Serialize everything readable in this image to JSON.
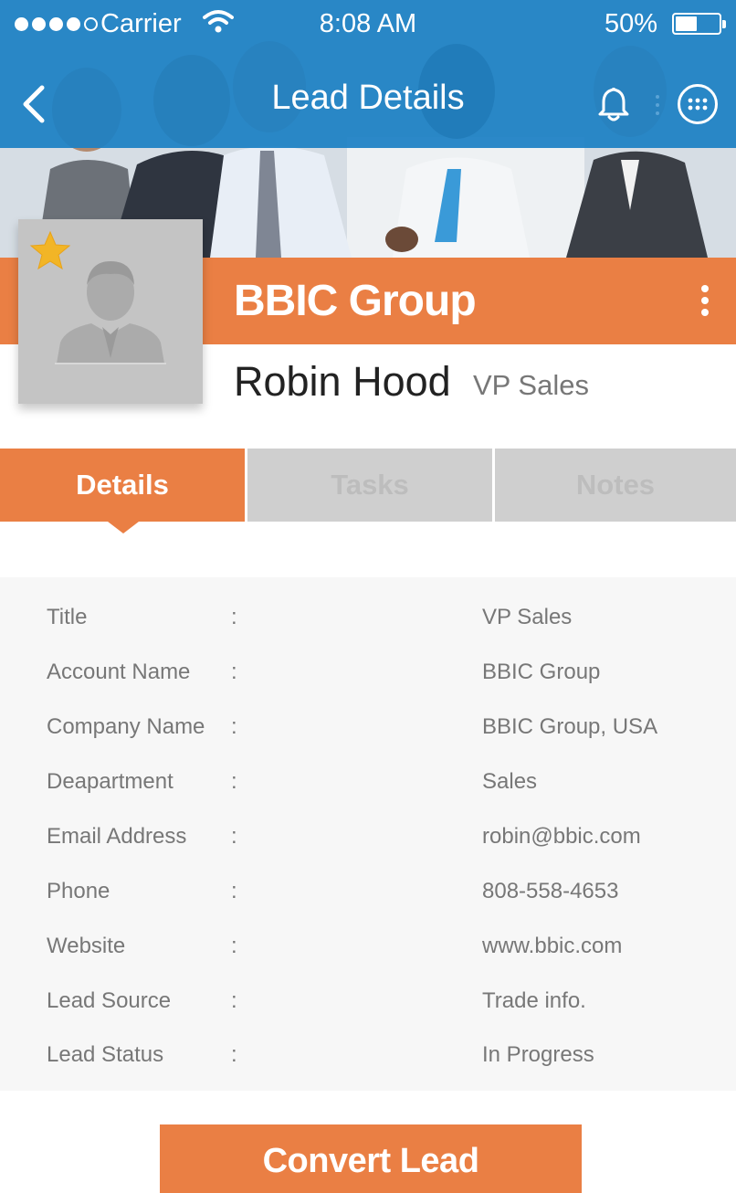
{
  "status_bar": {
    "carrier": "Carrier",
    "time": "8:08 AM",
    "battery": "50%",
    "battery_level": 0.5
  },
  "nav": {
    "title": "Lead Details",
    "back_icon": "chevron-left-icon",
    "notification_icon": "bell-icon",
    "menu_icon": "apps-grid-icon"
  },
  "lead": {
    "company": "BBIC Group",
    "name": "Robin Hood",
    "job_title": "VP Sales",
    "favorite": true
  },
  "tabs": [
    {
      "label": "Details",
      "active": true
    },
    {
      "label": "Tasks",
      "active": false
    },
    {
      "label": "Notes",
      "active": false
    }
  ],
  "details": [
    {
      "label": "Title",
      "value": "VP Sales"
    },
    {
      "label": "Account Name",
      "value": "BBIC Group"
    },
    {
      "label": "Company Name",
      "value": "BBIC Group, USA"
    },
    {
      "label": "Deapartment",
      "value": "Sales"
    },
    {
      "label": "Email Address",
      "value": "robin@bbic.com"
    },
    {
      "label": "Phone",
      "value": "808-558-4653"
    },
    {
      "label": "Website",
      "value": "www.bbic.com"
    },
    {
      "label": "Lead Source",
      "value": "Trade info."
    },
    {
      "label": "Lead Status",
      "value": "In Progress"
    }
  ],
  "separator": ":",
  "action": {
    "convert_label": "Convert Lead"
  },
  "colors": {
    "primary_blue": "#1c80c4",
    "accent_orange": "#ea7f44",
    "star_yellow": "#f2b526"
  }
}
